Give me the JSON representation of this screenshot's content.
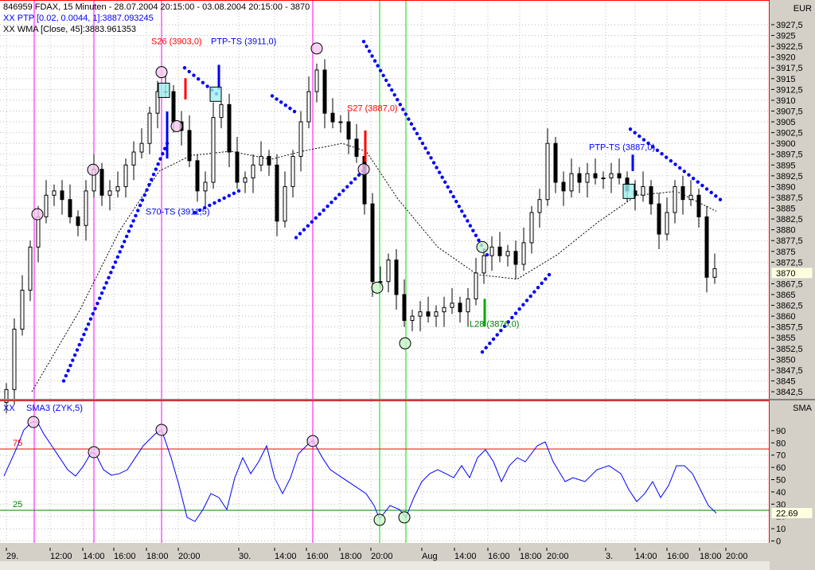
{
  "header": {
    "title": "846959  FDAX, 15 Minuten - 28.07.2004 20:15:00 - 03.08.2004 20:15:00 - 3870",
    "ptp": "XX PTP [0.02, 0.0044, 1]:3887.093245",
    "wma": "XX WMA [Close, 45]:3883.961353"
  },
  "colors": {
    "up": "#ffffff",
    "down": "#000000",
    "ptp": "#0000ff",
    "wma": "#000000",
    "sma": "#0000ff",
    "border": "#ff0000",
    "magenta": "#ff00ff",
    "green": "#00cc00",
    "axis_bg": "#d4d0c8"
  },
  "chart_data": [
    {
      "type": "candlestick",
      "title": "FDAX, 15 Minuten",
      "ylabel": "EUR",
      "ylim": [
        3842.5,
        3927.5
      ],
      "yticks": [
        "3927,5",
        "3925",
        "3922,5",
        "3920",
        "3917,5",
        "3915",
        "3912,5",
        "3910",
        "3907,5",
        "3905",
        "3902,5",
        "3900",
        "3897,5",
        "3895",
        "3892,5",
        "3890",
        "3887,5",
        "3885",
        "3882,5",
        "3880",
        "3877,5",
        "3875",
        "3872,5",
        "3870",
        "3867,5",
        "3865",
        "3862,5",
        "3860",
        "3857,5",
        "3855",
        "3852,5",
        "3850",
        "3847,5",
        "3845",
        "3842,5"
      ],
      "current_price": "3870",
      "closes": [
        3843,
        3857,
        3866,
        3876,
        3883,
        3888,
        3889,
        3887,
        3883,
        3881,
        3889,
        3894,
        3888,
        3889,
        3890,
        3895,
        3898,
        3900,
        3907,
        3912,
        3912,
        3905,
        3903,
        3896,
        3889,
        3891,
        3906,
        3909,
        3898,
        3891,
        3892,
        3895,
        3897,
        3895,
        3882,
        3890,
        3897,
        3905,
        3912,
        3917,
        3907,
        3905,
        3905,
        3901,
        3897,
        3886,
        3868,
        3868,
        3873,
        3865,
        3859,
        3860,
        3861,
        3860,
        3861,
        3862,
        3863,
        3861,
        3864,
        3870,
        3874,
        3876,
        3874,
        3875,
        3872,
        3877,
        3884,
        3887,
        3900,
        3891,
        3889,
        3893,
        3891,
        3893,
        3892,
        3892,
        3893,
        3892,
        3889,
        3888,
        3890,
        3886,
        3879,
        3884,
        3890,
        3887,
        3888,
        3883,
        3869,
        3871
      ],
      "wma": [
        [
          3.2,
          3842.5
        ],
        [
          9.2,
          3861.3
        ],
        [
          14.2,
          3879.7
        ],
        [
          19.2,
          3893.6
        ],
        [
          23.2,
          3897.2
        ],
        [
          28.2,
          3898.2
        ],
        [
          33.2,
          3896.3
        ],
        [
          37.2,
          3898.2
        ],
        [
          42.2,
          3900
        ],
        [
          45.2,
          3898.2
        ],
        [
          49.2,
          3887.1
        ],
        [
          54.2,
          3876
        ],
        [
          59.2,
          3869.6
        ],
        [
          64.2,
          3868.6
        ],
        [
          69.2,
          3874.2
        ],
        [
          74.2,
          3881.6
        ],
        [
          79.2,
          3888
        ],
        [
          84.2,
          3888.9
        ],
        [
          89.2,
          3884.3
        ]
      ],
      "ptp_segments": [
        [
          [
            7.2,
            3845
          ],
          [
            20.2,
            3900
          ]
        ],
        [
          [
            22.4,
            3917.5
          ],
          [
            26.4,
            3911.5
          ]
        ],
        [
          [
            23.7,
            3884
          ],
          [
            29.2,
            3889
          ]
        ],
        [
          [
            33.4,
            3911
          ],
          [
            36.2,
            3907.4
          ]
        ],
        [
          [
            36.4,
            3878.2
          ],
          [
            44.8,
            3893.6
          ]
        ],
        [
          [
            44.9,
            3923.6
          ],
          [
            60.4,
            3874.2
          ]
        ],
        [
          [
            59.8,
            3851.7
          ],
          [
            68.2,
            3869.6
          ]
        ],
        [
          [
            78.4,
            3903.3
          ],
          [
            89.7,
            3887
          ]
        ]
      ],
      "signal_bars": [
        {
          "i": 22.5,
          "from": 3910.2,
          "to": 3915.1,
          "color": "#ff0000"
        },
        {
          "i": 26.7,
          "from": 3912.5,
          "to": 3918.2,
          "color": "#0000ff"
        },
        {
          "i": 20.2,
          "from": 3896.5,
          "to": 3907.4,
          "color": "#0000ff"
        },
        {
          "i": 45.1,
          "from": 3895.7,
          "to": 3903,
          "color": "#ff0000"
        },
        {
          "i": 60.1,
          "from": 3857.6,
          "to": 3864,
          "color": "#00aa00"
        },
        {
          "i": 78.7,
          "from": 3893.6,
          "to": 3897.4,
          "color": "#0000ff"
        }
      ],
      "circles": [
        {
          "i": 3.9,
          "p": 3883.6,
          "kind": "high"
        },
        {
          "i": 10.9,
          "p": 3893.9,
          "kind": "high"
        },
        {
          "i": 19.5,
          "p": 3916.5,
          "kind": "high"
        },
        {
          "i": 21.4,
          "p": 3904,
          "kind": "high"
        },
        {
          "i": 39,
          "p": 3922,
          "kind": "high"
        },
        {
          "i": 44.9,
          "p": 3894,
          "kind": "high"
        },
        {
          "i": 46.6,
          "p": 3866.6,
          "kind": "low"
        },
        {
          "i": 50.1,
          "p": 3853.7,
          "kind": "low"
        },
        {
          "i": 59.8,
          "p": 3876,
          "kind": "low"
        }
      ],
      "squares": [
        {
          "i": 19.8,
          "p": 3912.3
        },
        {
          "i": 26.3,
          "p": 3911.4
        },
        {
          "i": 78.2,
          "p": 3888.9
        }
      ],
      "labels": [
        {
          "text": "S26 (3903,0)",
          "i": 18.2,
          "p": 3923,
          "color": "#ff0000"
        },
        {
          "text": "PTP-TS (3911,0)",
          "i": 25.7,
          "p": 3923,
          "color": "#0000ff"
        },
        {
          "text": "S27 (3887,0)",
          "i": 42.8,
          "p": 3907.5,
          "color": "#ff0000"
        },
        {
          "text": "S70-TS (3911,5)",
          "i": 17.5,
          "p": 3883.5,
          "color": "#0000ff"
        },
        {
          "text": "L28 (3876,0)",
          "i": 58.2,
          "p": 3857.5,
          "color": "#008000"
        },
        {
          "text": "PTP-TS (3887,0)",
          "i": 73.2,
          "p": 3898.5,
          "color": "#0000ff"
        }
      ]
    },
    {
      "type": "line",
      "title": "SMA3 (ZYK,5)",
      "prefix": "XX",
      "ylabel": "SMA",
      "ylim": [
        0,
        100
      ],
      "yticks": [
        "90",
        "80",
        "70",
        "60",
        "50",
        "40",
        "30",
        "20",
        "10",
        "0"
      ],
      "levels": [
        {
          "value": 75,
          "label": "75",
          "color": "#ff0000"
        },
        {
          "value": 25,
          "label": "25",
          "color": "#008000"
        }
      ],
      "current_value": "22.69",
      "points": [
        [
          -0.3,
          52.9
        ],
        [
          1.2,
          74.4
        ],
        [
          2.2,
          90.6
        ],
        [
          3.2,
          97
        ],
        [
          3.9,
          97
        ],
        [
          4.7,
          87.3
        ],
        [
          5.7,
          77.6
        ],
        [
          6.7,
          67.9
        ],
        [
          7.7,
          58.1
        ],
        [
          8.7,
          52.9
        ],
        [
          9.7,
          61.4
        ],
        [
          10.7,
          72.4
        ],
        [
          11.2,
          71.1
        ],
        [
          12.2,
          58.1
        ],
        [
          13.2,
          53.6
        ],
        [
          14.2,
          54.9
        ],
        [
          15.2,
          58.1
        ],
        [
          16.2,
          67.9
        ],
        [
          17.2,
          77.6
        ],
        [
          18.7,
          87.3
        ],
        [
          19.5,
          90.6
        ],
        [
          20.7,
          67.9
        ],
        [
          21.7,
          45.1
        ],
        [
          22.7,
          19.2
        ],
        [
          23.7,
          15.9
        ],
        [
          24.7,
          25.6
        ],
        [
          25.7,
          38.6
        ],
        [
          26.7,
          35.4
        ],
        [
          27.7,
          25.6
        ],
        [
          28.7,
          51.6
        ],
        [
          29.7,
          67.9
        ],
        [
          30.7,
          54.9
        ],
        [
          31.7,
          64.6
        ],
        [
          32.7,
          77.6
        ],
        [
          33.7,
          51.6
        ],
        [
          34.7,
          38.6
        ],
        [
          35.7,
          51.6
        ],
        [
          36.7,
          71.1
        ],
        [
          37.7,
          77.6
        ],
        [
          38.5,
          82.1
        ],
        [
          39.7,
          67.9
        ],
        [
          40.7,
          58.1
        ],
        [
          42.2,
          51.6
        ],
        [
          43.7,
          45.1
        ],
        [
          45.2,
          38.6
        ],
        [
          46.2,
          28.9
        ],
        [
          46.9,
          17.9
        ],
        [
          48.2,
          28.9
        ],
        [
          49.4,
          25.6
        ],
        [
          50.2,
          19.2
        ],
        [
          51.2,
          35.4
        ],
        [
          52.2,
          48.4
        ],
        [
          53.2,
          54.9
        ],
        [
          54.2,
          58.1
        ],
        [
          55.2,
          54.9
        ],
        [
          56.2,
          51.6
        ],
        [
          57.2,
          61.4
        ],
        [
          58.2,
          51.6
        ],
        [
          59.2,
          67.9
        ],
        [
          60.2,
          74.4
        ],
        [
          61.2,
          64.6
        ],
        [
          62.2,
          48.4
        ],
        [
          63.2,
          61.4
        ],
        [
          64.2,
          67.9
        ],
        [
          65.2,
          64.6
        ],
        [
          66.7,
          77.6
        ],
        [
          67.7,
          80.8
        ],
        [
          68.7,
          64.6
        ],
        [
          70.2,
          48.4
        ],
        [
          71.2,
          51.6
        ],
        [
          72.7,
          48.4
        ],
        [
          74.2,
          58.1
        ],
        [
          75.7,
          61.4
        ],
        [
          77.2,
          54.9
        ],
        [
          78.2,
          41.9
        ],
        [
          79.2,
          32.1
        ],
        [
          80.2,
          38.6
        ],
        [
          81.2,
          48.4
        ],
        [
          82.2,
          35.4
        ],
        [
          83.2,
          45.1
        ],
        [
          84.2,
          61.4
        ],
        [
          85.2,
          61.4
        ],
        [
          86.2,
          54.9
        ],
        [
          87.2,
          41.9
        ],
        [
          88.2,
          28.9
        ],
        [
          89.2,
          22.7
        ]
      ],
      "circles": [
        {
          "i": 3.4,
          "v": 97,
          "kind": "high"
        },
        {
          "i": 11,
          "v": 72.4,
          "kind": "high"
        },
        {
          "i": 19.5,
          "v": 90.6,
          "kind": "high"
        },
        {
          "i": 38.5,
          "v": 81.5,
          "kind": "high"
        },
        {
          "i": 46.9,
          "v": 17.2,
          "kind": "low"
        },
        {
          "i": 50,
          "v": 19.2,
          "kind": "low"
        }
      ]
    }
  ],
  "vertical_lines": [
    {
      "i": 3.5,
      "color": "#ff00ff"
    },
    {
      "i": 11,
      "color": "#ff00ff"
    },
    {
      "i": 19.5,
      "color": "#ff00ff"
    },
    {
      "i": 38.5,
      "color": "#ff00ff"
    },
    {
      "i": 46.9,
      "color": "#00dd00"
    },
    {
      "i": 50.2,
      "color": "#00dd00"
    }
  ],
  "time_axis": [
    {
      "label": "29.",
      "i": 0
    },
    {
      "label": "12:00",
      "i": 5.5
    },
    {
      "label": "14:00",
      "i": 9.6
    },
    {
      "label": "16:00",
      "i": 13.5
    },
    {
      "label": "18:00",
      "i": 17.6
    },
    {
      "label": "20:00",
      "i": 21.6
    },
    {
      "label": "30.",
      "i": 29.2
    },
    {
      "label": "14:00",
      "i": 33.7
    },
    {
      "label": "16:00",
      "i": 37.7
    },
    {
      "label": "18:00",
      "i": 41.9
    },
    {
      "label": "20:00",
      "i": 45.8
    },
    {
      "label": "Aug",
      "i": 52.2
    },
    {
      "label": "14:00",
      "i": 56.3
    },
    {
      "label": "16:00",
      "i": 60.5
    },
    {
      "label": "18:00",
      "i": 64.5
    },
    {
      "label": "20:00",
      "i": 67.9
    },
    {
      "label": "3.",
      "i": 75.3
    },
    {
      "label": "14:00",
      "i": 79
    },
    {
      "label": "16:00",
      "i": 83
    },
    {
      "label": "18:00",
      "i": 87.1
    },
    {
      "label": "20:00",
      "i": 90.4
    }
  ]
}
